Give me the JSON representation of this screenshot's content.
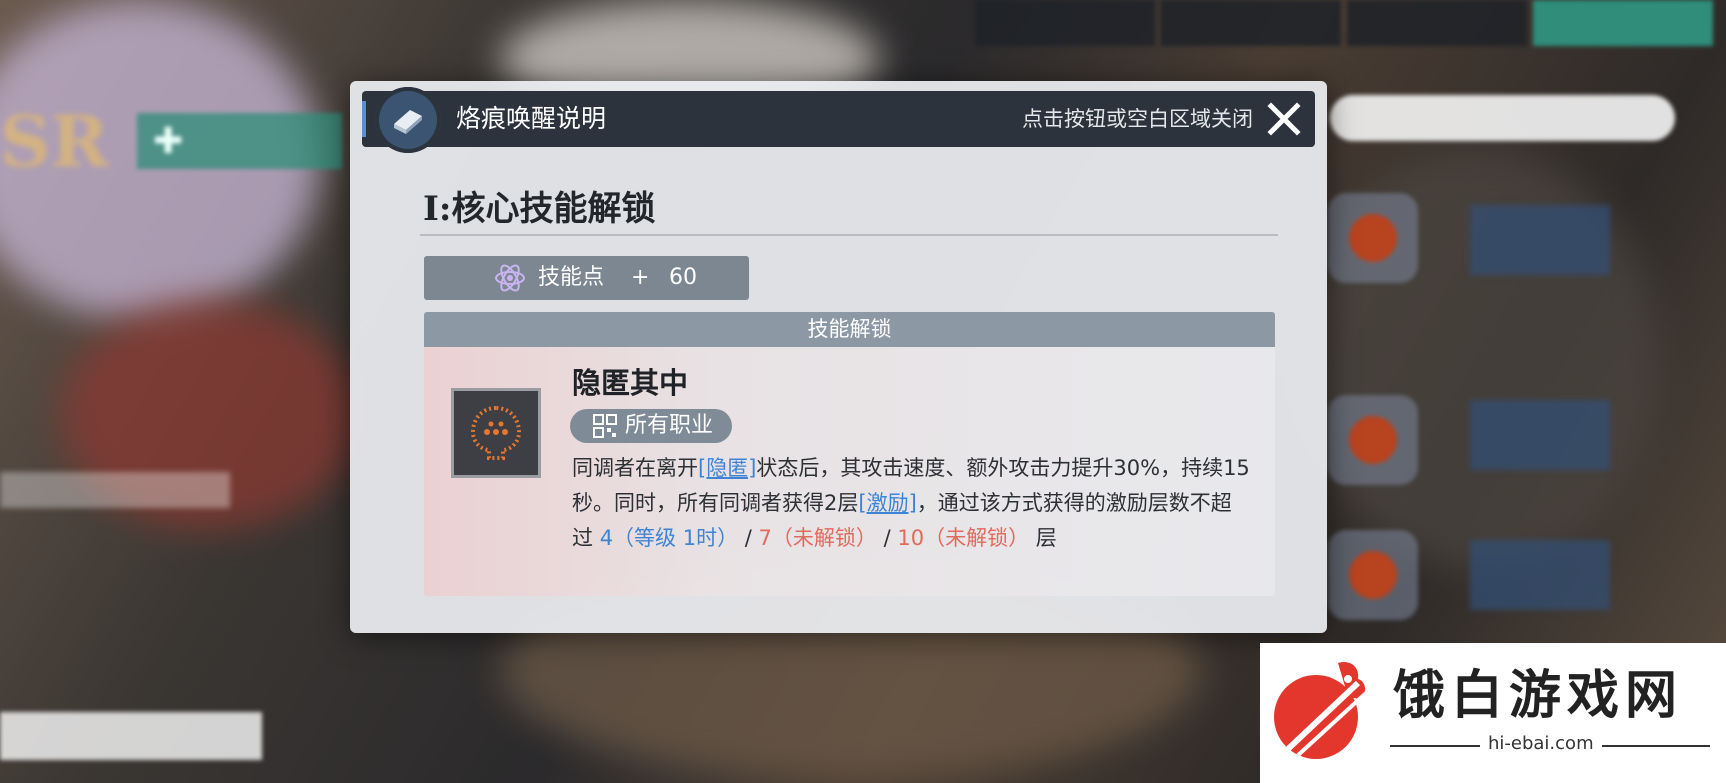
{
  "background": {
    "top_tabs": [
      "",
      "",
      "",
      ""
    ],
    "role_tag": "",
    "search_placeholder": "",
    "bottom_button": ""
  },
  "modal": {
    "title": "烙痕唤醒说明",
    "close_hint": "点击按钮或空白区域关闭",
    "section_title": "I:核心技能解锁",
    "skill_points": {
      "label": "技能点",
      "plus": "+",
      "value": "60"
    },
    "unlock_bar_label": "技能解锁",
    "skill": {
      "name": "隐匿其中",
      "class_tag": "所有职业",
      "desc_part1": "同调者在离开",
      "kw_hide": "[隐匿]",
      "desc_part2": "状态后，其攻击速度、额外攻击力提升30%，持续15秒。同时，所有同调者获得2层",
      "kw_inspire": "[激励]",
      "desc_part3": "，通过该方式获得的激励层数不超过",
      "level1": "4（等级 1时）",
      "sep": "/",
      "level2": "7（未解锁）",
      "level3": "10（未解锁）",
      "desc_end": "层"
    },
    "colors": {
      "keyword": "#3e84d6",
      "locked": "#e26a5d",
      "header_bg": "#2c333d"
    }
  },
  "watermark": {
    "brand": "饿白游戏网",
    "url": "hi-ebai.com"
  }
}
